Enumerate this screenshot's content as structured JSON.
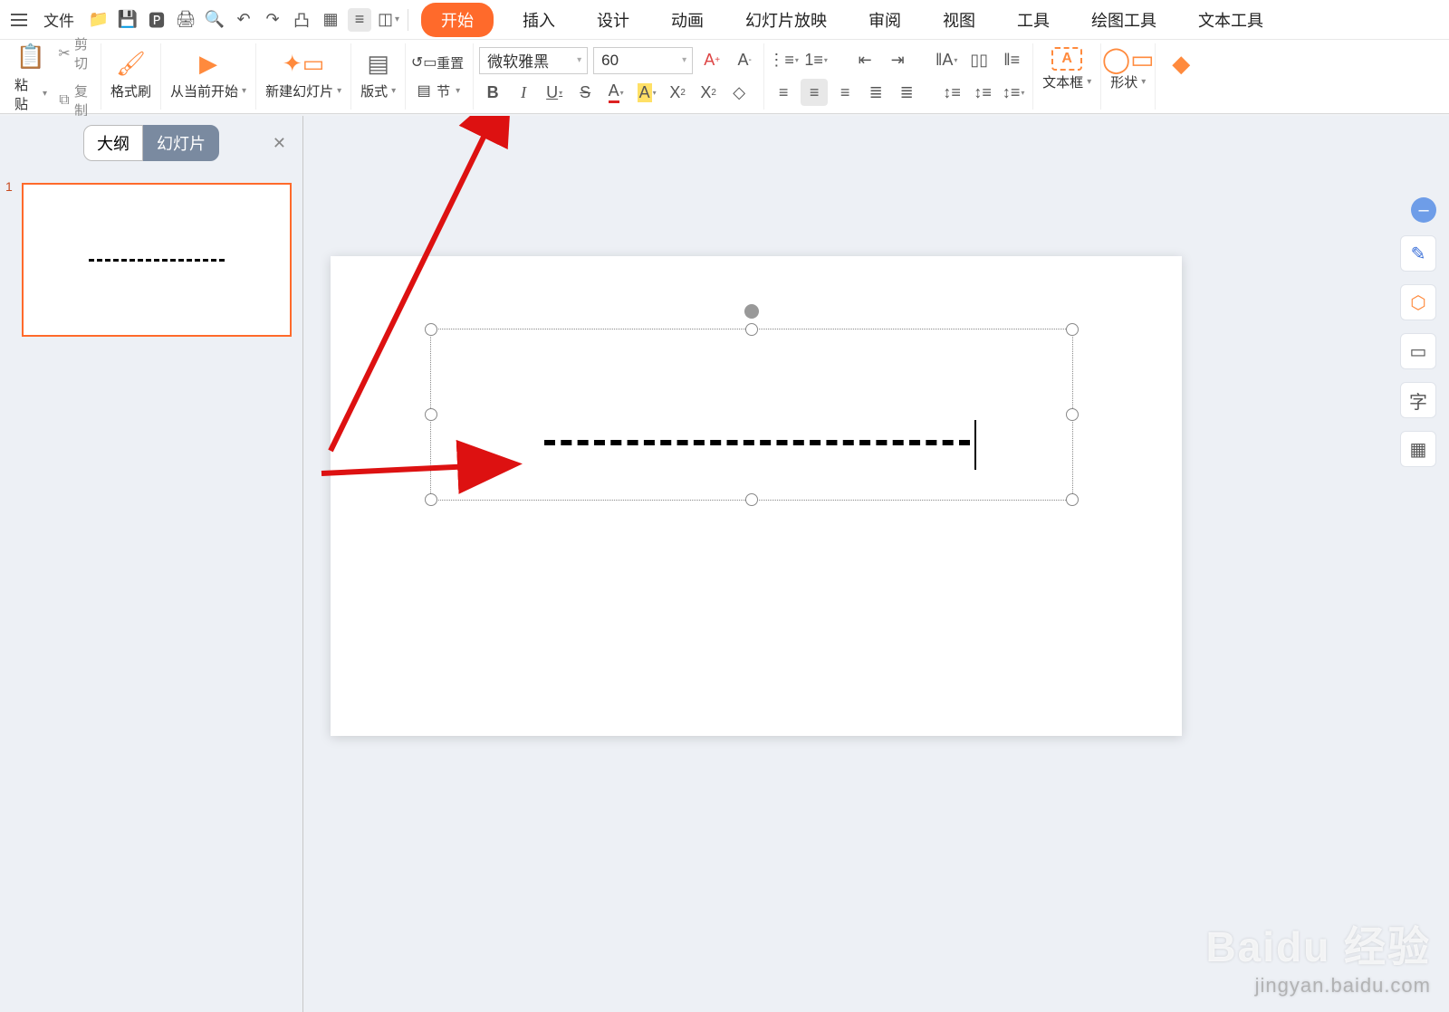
{
  "menubar": {
    "file": "文件",
    "tabs": [
      "开始",
      "插入",
      "设计",
      "动画",
      "幻灯片放映",
      "审阅",
      "视图",
      "工具",
      "绘图工具",
      "文本工具"
    ],
    "active_tab_index": 0
  },
  "ribbon": {
    "paste": "粘贴",
    "cut": "剪切",
    "copy": "复制",
    "format_painter": "格式刷",
    "from_current": "从当前开始",
    "new_slide": "新建幻灯片",
    "layout": "版式",
    "reset": "重置",
    "section": "节",
    "font_name": "微软雅黑",
    "font_size": "60",
    "text_box": "文本框",
    "shape": "形状"
  },
  "panel": {
    "tab_outline": "大纲",
    "tab_slides": "幻灯片",
    "slide_number": "1"
  },
  "float_labels": {
    "char": "字"
  },
  "watermark": {
    "brand": "Baidu 经验",
    "url": "jingyan.baidu.com"
  }
}
